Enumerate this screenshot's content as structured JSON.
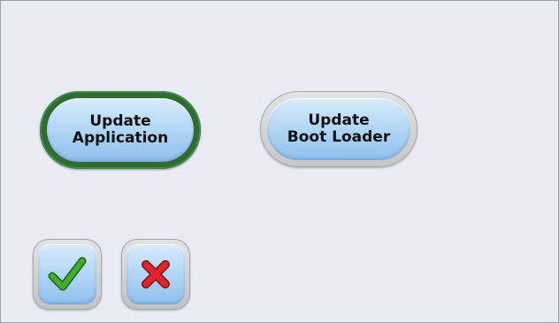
{
  "buttons": {
    "update_application": {
      "line1": "Update",
      "line2": "Application",
      "selected": true
    },
    "update_boot_loader": {
      "line1": "Update",
      "line2": "Boot Loader",
      "selected": false
    },
    "confirm": {
      "icon": "checkmark-icon",
      "color": "#3a9a2a"
    },
    "cancel": {
      "icon": "x-icon",
      "color": "#d8202a"
    }
  },
  "colors": {
    "background": "#e9ebf5",
    "selected_border": "#2f6b33",
    "button_face": "#b5d8f6"
  }
}
